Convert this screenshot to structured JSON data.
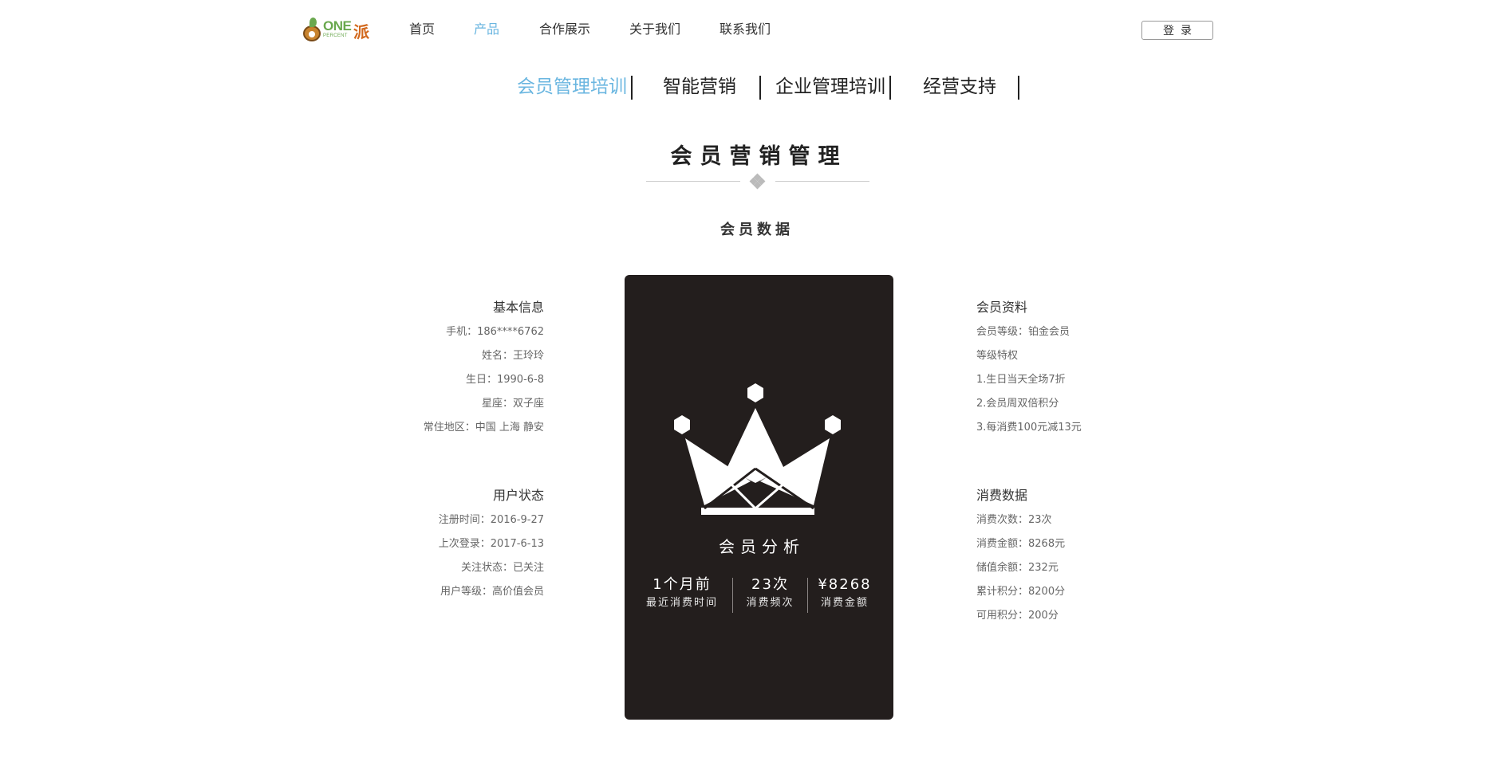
{
  "brand": {
    "logo_text": "ONE",
    "logo_subtext": "PERCENT",
    "logo_cn": "派"
  },
  "nav": {
    "items": [
      {
        "label": "首页",
        "active": false
      },
      {
        "label": "产品",
        "active": true
      },
      {
        "label": "合作展示",
        "active": false
      },
      {
        "label": "关于我们",
        "active": false
      },
      {
        "label": "联系我们",
        "active": false
      }
    ],
    "login_label": "登录"
  },
  "tabs": [
    {
      "label": "会员管理培训",
      "active": true
    },
    {
      "label": "智能营销",
      "active": false
    },
    {
      "label": "企业管理培训",
      "active": false
    },
    {
      "label": "经营支持",
      "active": false
    }
  ],
  "section": {
    "title": "会员营销管理",
    "subtitle": "会员数据"
  },
  "basic_info": {
    "title": "基本信息",
    "rows": [
      "手机：186****6762",
      "姓名：王玲玲",
      "生日：1990-6-8",
      "星座：双子座",
      "常住地区：中国 上海 静安"
    ]
  },
  "user_status": {
    "title": "用户状态",
    "rows": [
      "注册时间：2016-9-27",
      "上次登录：2017-6-13",
      "关注状态：已关注",
      "用户等级：高价值会员"
    ]
  },
  "member_profile": {
    "title": "会员资料",
    "rows": [
      "会员等级：铂金会员",
      "等级特权",
      "1.生日当天全场7折",
      "2.会员周双倍积分",
      "3.每消费100元减13元"
    ]
  },
  "spending": {
    "title": "消费数据",
    "rows": [
      "消费次数：23次",
      "消费金额：8268元",
      "储值余额：232元",
      "累计积分：8200分",
      "可用积分：200分"
    ]
  },
  "card": {
    "title": "会员分析",
    "icon": "crown-icon",
    "background": "#231e1d",
    "stats": [
      {
        "value": "1个月前",
        "label": "最近消费时间"
      },
      {
        "value": "23次",
        "label": "消费频次"
      },
      {
        "value": "¥8268",
        "label": "消费金额"
      }
    ]
  },
  "colors": {
    "accent": "#6ab6e0",
    "card_bg": "#231e1d"
  }
}
